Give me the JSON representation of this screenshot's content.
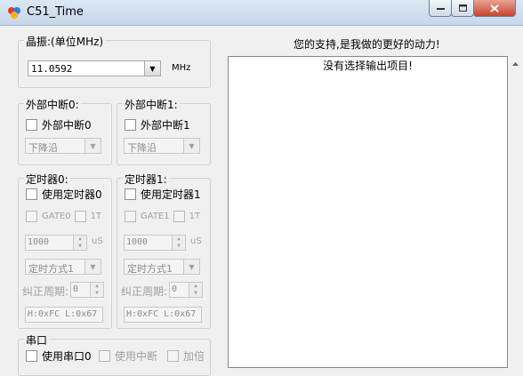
{
  "window": {
    "title": "C51_Time"
  },
  "crystal": {
    "label": "晶振:(单位MHz)",
    "value": "11.0592",
    "unit": "MHz"
  },
  "ext0": {
    "label": "外部中断0:",
    "check_label": "外部中断0",
    "edge": "下降沿"
  },
  "ext1": {
    "label": "外部中断1:",
    "check_label": "外部中断1",
    "edge": "下降沿"
  },
  "timer0": {
    "label": "定时器0:",
    "use_label": "使用定时器0",
    "gate_label": "GATE0",
    "t_label": "1T",
    "time_value": "1000",
    "time_unit": "uS",
    "mode": "定时方式1",
    "corr_label": "纠正周期:",
    "corr_value": "0",
    "reg_text": "H:0xFC L:0x67"
  },
  "timer1": {
    "label": "定时器1:",
    "use_label": "使用定时器1",
    "gate_label": "GATE1",
    "t_label": "1T",
    "time_value": "1000",
    "time_unit": "uS",
    "mode": "定时方式1",
    "corr_label": "纠正周期:",
    "corr_value": "0",
    "reg_text": "H:0xFC L:0x67"
  },
  "serial": {
    "label": "串口",
    "use_label": "使用串口0",
    "interrupt_label": "使用中断",
    "double_label": "加倍"
  },
  "output": {
    "thanks": "您的支持,是我做的更好的动力!",
    "message": "没有选择输出项目!"
  }
}
